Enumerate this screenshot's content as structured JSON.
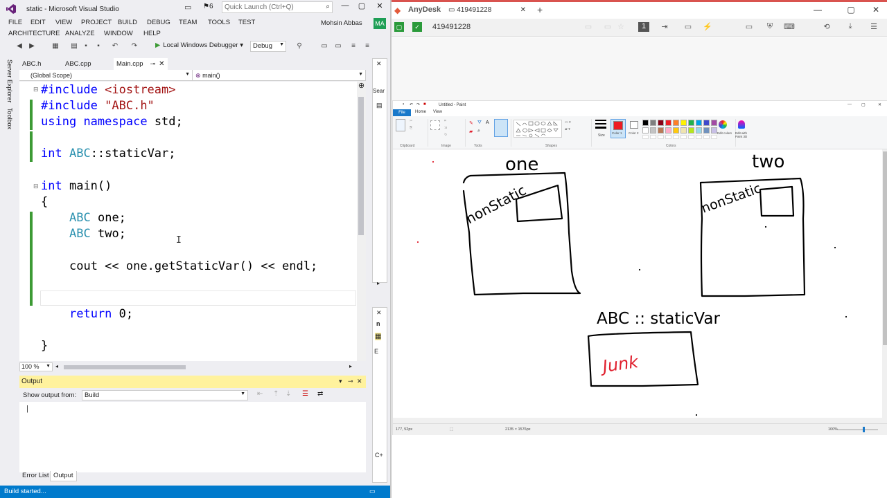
{
  "vs": {
    "window_title": "static - Microsoft Visual Studio",
    "notification_count": "6",
    "quick_launch_placeholder": "Quick Launch (Ctrl+Q)",
    "menu": [
      "FILE",
      "EDIT",
      "VIEW",
      "PROJECT",
      "BUILD",
      "DEBUG",
      "TEAM",
      "TOOLS",
      "TEST",
      "ARCHITECTURE",
      "ANALYZE",
      "WINDOW",
      "HELP"
    ],
    "user_name": "Mohsin Abbas",
    "user_initials": "MA",
    "toolbar": {
      "debugger_label": "Local Windows Debugger",
      "config": "Debug"
    },
    "sidebar": [
      "Server Explorer",
      "Toolbox"
    ],
    "tabs": [
      "ABC.h",
      "ABC.cpp",
      "Main.cpp"
    ],
    "scope": {
      "left": "(Global Scope)",
      "right": "main()"
    },
    "code": {
      "l1_kw": "#include",
      "l1_str": "<iostream>",
      "l2_kw": "#include",
      "l2_str": "\"ABC.h\"",
      "l3_a": "using",
      "l3_b": "namespace",
      "l3_c": "std;",
      "l4_a": "int",
      "l4_type": "ABC",
      "l4_rest": "::staticVar;",
      "l5_a": "int",
      "l5_rest": "main()",
      "l6": "{",
      "l7_type": "ABC",
      "l7_rest": "one;",
      "l8_type": "ABC",
      "l8_rest": "two;",
      "l9": "cout << one.getStaticVar() << endl;",
      "l10_kw": "return",
      "l10_rest": "0;",
      "l11": "}"
    },
    "zoom": "100 %",
    "output": {
      "title": "Output",
      "show_from_label": "Show output from:",
      "source": "Build"
    },
    "bottom_tabs": [
      "Error List",
      "Output"
    ],
    "status": "Build started...",
    "rail": {
      "search_label": "Sear",
      "letter_n": "n",
      "letter_e": "E",
      "letter_c": "C+"
    }
  },
  "anydesk": {
    "app_name": "AnyDesk",
    "tab_id": "419491228",
    "connection_id": "419491228",
    "paint": {
      "title": "Untitled - Paint",
      "menu": [
        "File",
        "Home",
        "View"
      ],
      "groups": [
        "Clipboard",
        "Image",
        "Tools",
        "Shapes",
        "Colors"
      ],
      "size_label": "Size",
      "color1_label": "Color 1",
      "color2_label": "Color 2",
      "edit_colors_label": "Edit colors",
      "paint3d_label": "Edit with Paint 3D",
      "status_pos": "177, 52px",
      "status_size": "2135 × 1576px",
      "status_zoom": "100%",
      "drawing": {
        "label_one": "one",
        "label_two": "two",
        "box_text_left": "nonStatic",
        "box_text_right": "nonStatic",
        "static_label": "ABC :: staticVar",
        "junk": "Junk"
      },
      "palette": [
        "#000000",
        "#7f7f7f",
        "#880015",
        "#ed1c24",
        "#ff7f27",
        "#fff200",
        "#22b14c",
        "#00a2e8",
        "#3f48cc",
        "#a349a4",
        "#ffffff",
        "#c3c3c3",
        "#b97a57",
        "#ffaec9",
        "#ffc90e",
        "#efe4b0",
        "#b5e61d",
        "#99d9ea",
        "#7092be",
        "#c8bfe7"
      ]
    }
  },
  "colors": {
    "vs_accent": "#007acc",
    "output_header": "#fff29d",
    "ink_red": "#e0202e",
    "paint_file_tab": "#1979ca"
  }
}
